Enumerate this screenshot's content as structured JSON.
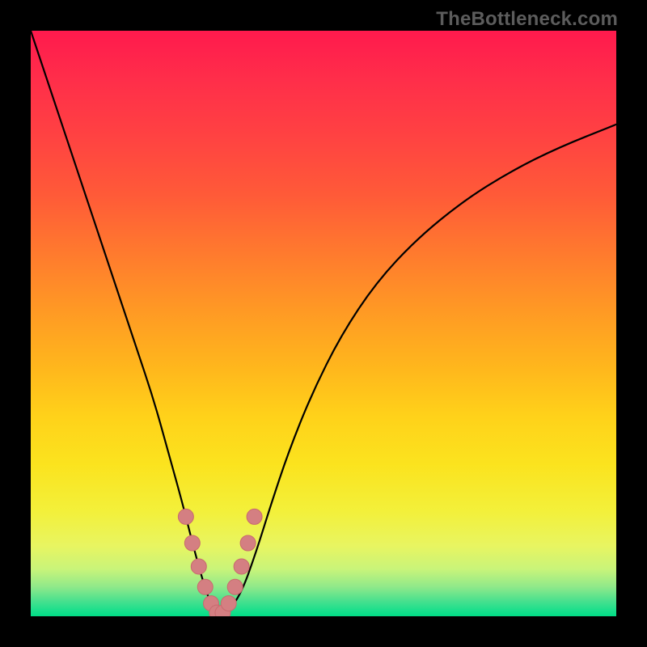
{
  "watermark": {
    "text": "TheBottleneck.com"
  },
  "colors": {
    "curve_stroke": "#000000",
    "marker_stroke": "#c86a6e",
    "marker_fill": "#d47f82"
  },
  "chart_data": {
    "type": "line",
    "title": "",
    "xlabel": "",
    "ylabel": "",
    "xlim": [
      0,
      100
    ],
    "ylim": [
      0,
      100
    ],
    "grid": false,
    "series": [
      {
        "name": "curve",
        "x": [
          0,
          4,
          8,
          12,
          15,
          18,
          21,
          23.5,
          26,
          28,
          30,
          31.5,
          33.5,
          36,
          38.5,
          41,
          44,
          48,
          53,
          59,
          66,
          74,
          82,
          90,
          100
        ],
        "y": [
          100,
          88,
          76,
          64,
          55,
          46,
          37,
          28,
          19,
          11,
          4,
          0.5,
          0.5,
          4,
          11,
          19,
          28,
          38,
          48,
          57,
          64.5,
          71,
          76,
          80,
          84
        ]
      }
    ],
    "markers": {
      "name": "highlight-near-minimum",
      "x": [
        26.5,
        27.6,
        28.7,
        29.8,
        30.8,
        31.8,
        32.8,
        33.8,
        34.9,
        36.0,
        37.1,
        38.2
      ],
      "y": [
        17.0,
        12.5,
        8.5,
        5.0,
        2.2,
        0.6,
        0.6,
        2.2,
        5.0,
        8.5,
        12.5,
        17.0
      ]
    }
  }
}
